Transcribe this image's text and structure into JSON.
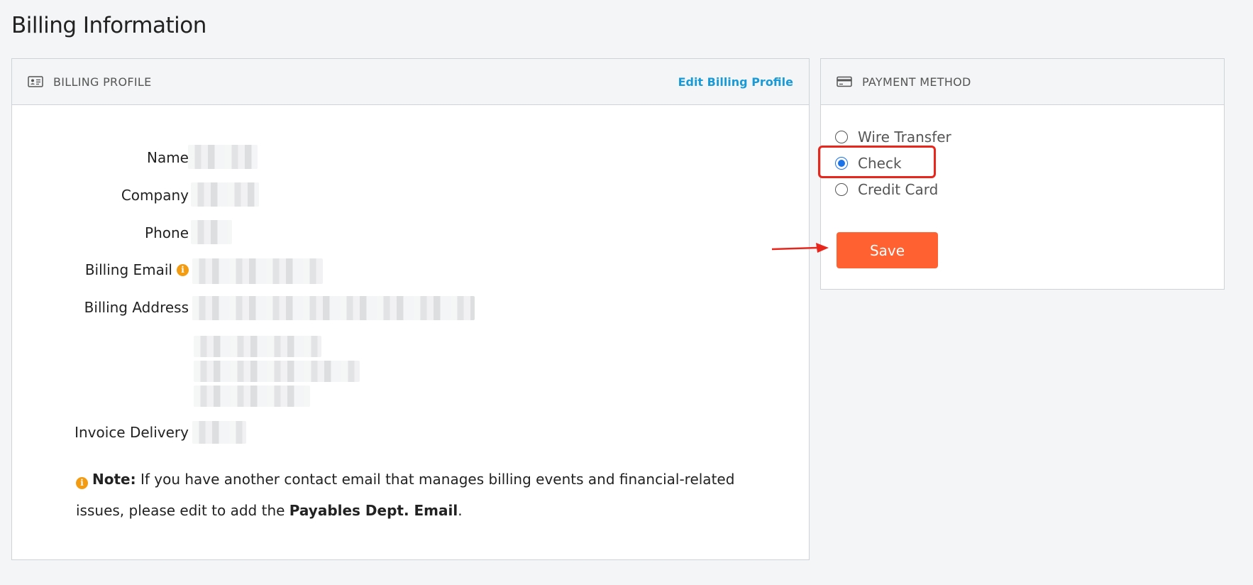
{
  "page": {
    "title": "Billing Information"
  },
  "billing_profile": {
    "header": "BILLING PROFILE",
    "edit_link": "Edit Billing Profile",
    "fields": {
      "name": "Name",
      "company": "Company",
      "phone": "Phone",
      "billing_email": "Billing Email",
      "billing_address": "Billing Address",
      "invoice_delivery": "Invoice Delivery"
    },
    "note": {
      "prefix": "Note:",
      "text": " If you have another contact email that manages billing events and financial-related issues, please edit to add the ",
      "bold": "Payables Dept. Email",
      "suffix": "."
    }
  },
  "payment_method": {
    "header": "PAYMENT METHOD",
    "options": [
      {
        "label": "Wire Transfer",
        "checked": false
      },
      {
        "label": "Check",
        "checked": true
      },
      {
        "label": "Credit Card",
        "checked": false
      }
    ],
    "save_label": "Save"
  },
  "colors": {
    "accent_link": "#1a9ad6",
    "save_button": "#ff6131",
    "radio_selected": "#1a73e8",
    "highlight": "#e8261c",
    "info": "#f39c12"
  }
}
